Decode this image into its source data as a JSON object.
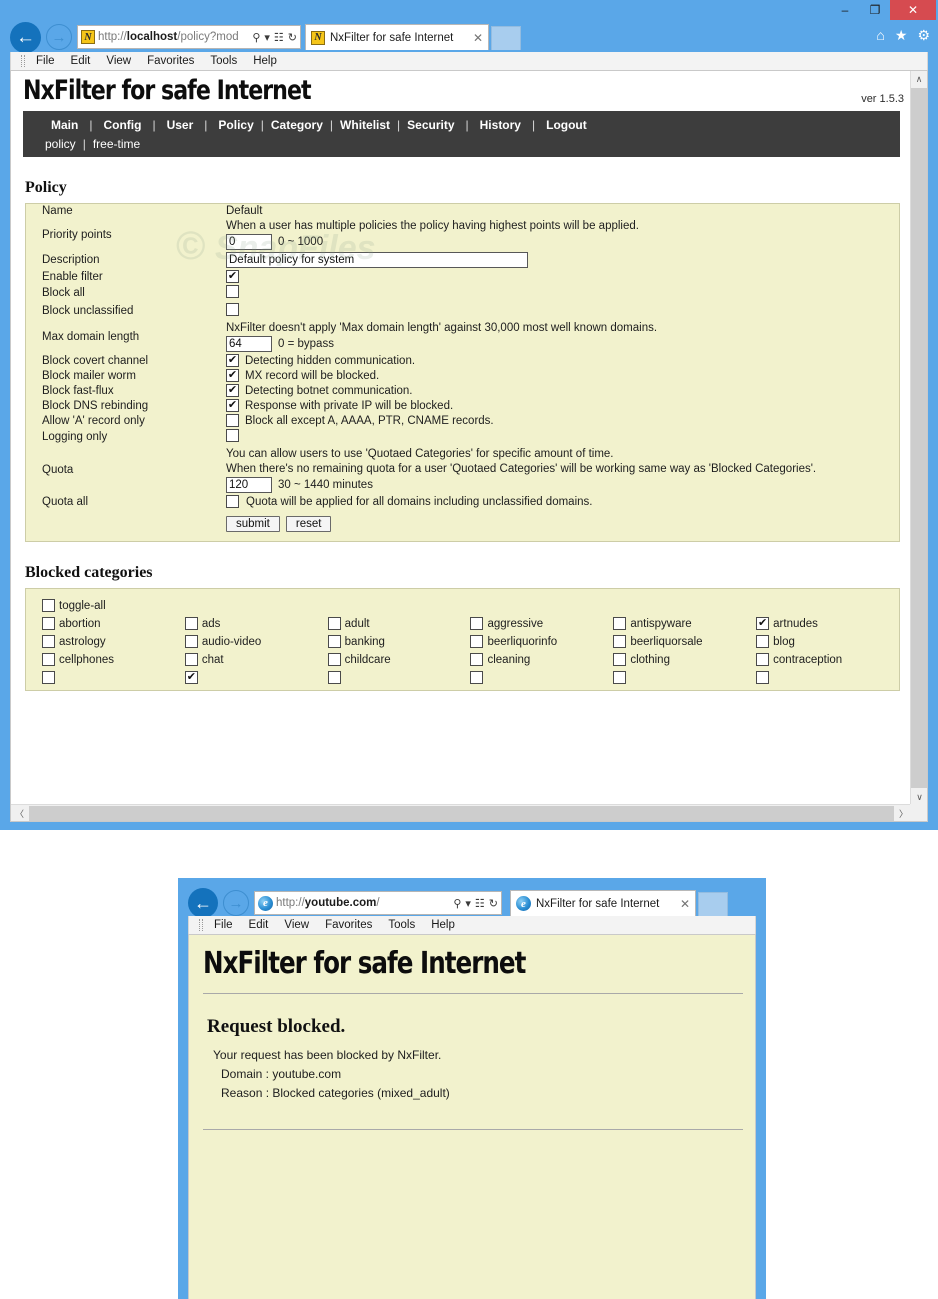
{
  "window1": {
    "titlebar": {
      "minimize": "–",
      "maximize": "❐",
      "close": "✕"
    },
    "nav": {
      "back": "←",
      "forward": "→"
    },
    "address": {
      "favicon": "nxfilter-favicon",
      "url_prefix": "http://",
      "url_host": "localhost",
      "url_rest": "/policy?mod",
      "search_icon": "⚲",
      "dropdown_icon": "▾",
      "compat_icon": "☷",
      "refresh_icon": "↻"
    },
    "tab": {
      "title": "NxFilter for safe Internet",
      "close": "✕"
    },
    "toolbar_icons": {
      "home": "⌂",
      "favorites": "★",
      "settings": "⚙"
    },
    "menubar": [
      "File",
      "Edit",
      "View",
      "Favorites",
      "Tools",
      "Help"
    ],
    "scroll": {
      "up": "∧",
      "down": "∨",
      "left": "〈",
      "right": "〉"
    }
  },
  "site": {
    "brand": "NxFilter for safe Internet",
    "version": "ver 1.5.3",
    "nav_primary": [
      "Main",
      "Config",
      "User",
      "Policy",
      "Category",
      "Whitelist",
      "Security",
      "History",
      "Logout"
    ],
    "nav_secondary": [
      "policy",
      "free-time"
    ],
    "watermark": "SnapFiles"
  },
  "policy": {
    "section_title": "Policy",
    "rows": {
      "name": {
        "label": "Name",
        "value": "Default"
      },
      "priority": {
        "label": "Priority points",
        "hint": "When a user has multiple policies the policy having highest points will be applied.",
        "value": "0",
        "range": "0 ~ 1000"
      },
      "description": {
        "label": "Description",
        "value": "Default policy for system"
      },
      "enable_filter": {
        "label": "Enable filter",
        "checked": true
      },
      "block_all": {
        "label": "Block all",
        "checked": false
      },
      "block_unclassified": {
        "label": "Block unclassified",
        "checked": false
      },
      "max_domain_length": {
        "label": "Max domain length",
        "hint": "NxFilter doesn't apply 'Max domain length' against 30,000 most well known domains.",
        "value": "64",
        "range": "0 = bypass"
      },
      "block_covert_channel": {
        "label": "Block covert channel",
        "checked": true,
        "text": "Detecting hidden communication."
      },
      "block_mailer_worm": {
        "label": "Block mailer worm",
        "checked": true,
        "text": "MX record will be blocked."
      },
      "block_fast_flux": {
        "label": "Block fast-flux",
        "checked": true,
        "text": "Detecting botnet communication."
      },
      "block_dns_rebinding": {
        "label": "Block DNS rebinding",
        "checked": true,
        "text": "Response with private IP will be blocked."
      },
      "allow_a_record_only": {
        "label": "Allow 'A' record only",
        "checked": false,
        "text": "Block all except A, AAAA, PTR, CNAME records."
      },
      "logging_only": {
        "label": "Logging only",
        "checked": false,
        "text": ""
      },
      "quota": {
        "label": "Quota",
        "hint1": "You can allow users to use 'Quotaed Categories' for specific amount of time.",
        "hint2": "When there's no remaining quota for a user 'Quotaed Categories' will be working same way as 'Blocked Categories'.",
        "value": "120",
        "range": "30 ~ 1440 minutes"
      },
      "quota_all": {
        "label": "Quota all",
        "checked": false,
        "text": "Quota will be applied for all domains including unclassified domains."
      }
    },
    "buttons": {
      "submit": "submit",
      "reset": "reset"
    }
  },
  "blocked_categories": {
    "section_title": "Blocked categories",
    "toggle_all": {
      "label": "toggle-all",
      "checked": false
    },
    "items": [
      {
        "label": "abortion",
        "checked": false
      },
      {
        "label": "ads",
        "checked": false
      },
      {
        "label": "adult",
        "checked": false
      },
      {
        "label": "aggressive",
        "checked": false
      },
      {
        "label": "antispyware",
        "checked": false
      },
      {
        "label": "artnudes",
        "checked": true
      },
      {
        "label": "astrology",
        "checked": false
      },
      {
        "label": "audio-video",
        "checked": false
      },
      {
        "label": "banking",
        "checked": false
      },
      {
        "label": "beerliquorinfo",
        "checked": false
      },
      {
        "label": "beerliquorsale",
        "checked": false
      },
      {
        "label": "blog",
        "checked": false
      },
      {
        "label": "cellphones",
        "checked": false
      },
      {
        "label": "chat",
        "checked": false
      },
      {
        "label": "childcare",
        "checked": false
      },
      {
        "label": "cleaning",
        "checked": false
      },
      {
        "label": "clothing",
        "checked": false
      },
      {
        "label": "contraception",
        "checked": false
      }
    ]
  },
  "window2": {
    "address": {
      "favicon": "internet-explorer-favicon",
      "url_prefix": "http://",
      "url_host": "youtube.com",
      "url_rest": "/",
      "search_icon": "⚲",
      "dropdown_icon": "▾",
      "compat_icon": "☷",
      "refresh_icon": "↻"
    },
    "tab": {
      "title": "NxFilter for safe Internet",
      "close": "✕"
    },
    "menubar": [
      "File",
      "Edit",
      "View",
      "Favorites",
      "Tools",
      "Help"
    ],
    "brand": "NxFilter for safe Internet",
    "heading": "Request blocked.",
    "line1": "Your request has been blocked by NxFilter.",
    "line2": "Domain : youtube.com",
    "line3": "Reason : Blocked categories (mixed_adult)"
  }
}
